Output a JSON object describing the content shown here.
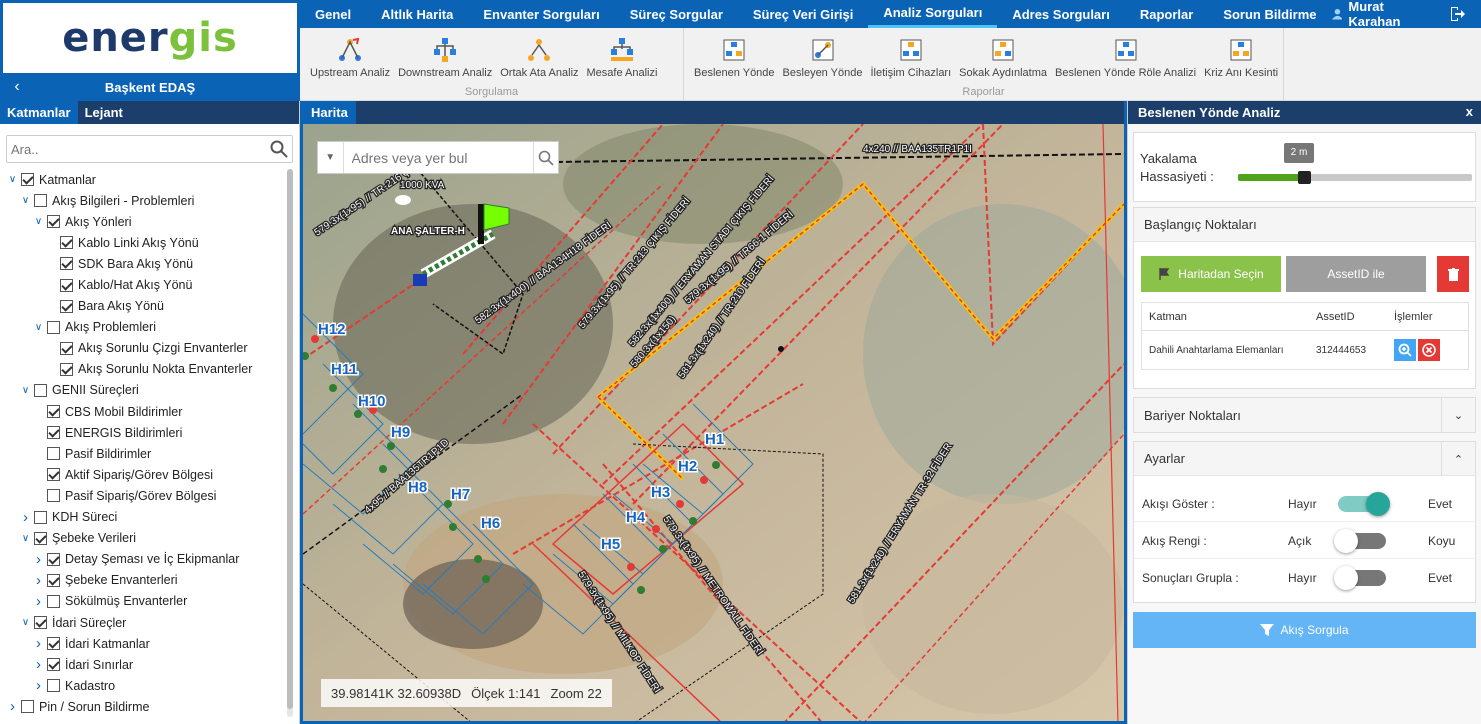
{
  "brand": {
    "logo_part1": "ener",
    "logo_part2": "gis",
    "company": "Başkent EDAŞ"
  },
  "nav": {
    "items": [
      "Genel",
      "Altlık Harita",
      "Envanter Sorguları",
      "Süreç Sorgular",
      "Süreç Veri Girişi",
      "Analiz Sorguları",
      "Adres Sorguları",
      "Raporlar",
      "Sorun Bildirme"
    ],
    "active": "Analiz Sorguları",
    "user": "Murat Karahan"
  },
  "ribbon": {
    "sorgulama": {
      "title": "Sorgulama",
      "buttons": [
        "Upstream Analiz",
        "Downstream Analiz",
        "Ortak Ata Analiz",
        "Mesafe Analizi"
      ]
    },
    "raporlar": {
      "title": "Raporlar",
      "buttons": [
        "Beslenen Yönde",
        "Besleyen Yönde",
        "İletişim Cihazları",
        "Sokak Aydınlatma",
        "Beslenen Yönde Röle Analizi",
        "Kriz Anı Kesinti"
      ]
    }
  },
  "left": {
    "tabs": [
      "Katmanlar",
      "Lejant"
    ],
    "search_placeholder": "Ara..",
    "tree": [
      {
        "label": "Katmanlar",
        "level": 0,
        "caret": "down",
        "checked": true
      },
      {
        "label": "Akış Bilgileri - Problemleri",
        "level": 1,
        "caret": "down",
        "checked": false
      },
      {
        "label": "Akış Yönleri",
        "level": 2,
        "caret": "down",
        "checked": true
      },
      {
        "label": "Kablo Linki Akış Yönü",
        "level": 3,
        "caret": "",
        "checked": true
      },
      {
        "label": "SDK Bara Akış Yönü",
        "level": 3,
        "caret": "",
        "checked": true
      },
      {
        "label": "Kablo/Hat Akış Yönü",
        "level": 3,
        "caret": "",
        "checked": true
      },
      {
        "label": "Bara Akış Yönü",
        "level": 3,
        "caret": "",
        "checked": true
      },
      {
        "label": "Akış Problemleri",
        "level": 2,
        "caret": "down",
        "checked": false
      },
      {
        "label": "Akış Sorunlu Çizgi Envanterler",
        "level": 3,
        "caret": "",
        "checked": true
      },
      {
        "label": "Akış Sorunlu Nokta Envanterler",
        "level": 3,
        "caret": "",
        "checked": true
      },
      {
        "label": "GENII Süreçleri",
        "level": 1,
        "caret": "down",
        "checked": false
      },
      {
        "label": "CBS Mobil Bildirimler",
        "level": 2,
        "caret": "",
        "checked": true
      },
      {
        "label": "ENERGIS Bildirimleri",
        "level": 2,
        "caret": "",
        "checked": true
      },
      {
        "label": "Pasif Bildirimler",
        "level": 2,
        "caret": "",
        "checked": false
      },
      {
        "label": "Aktif Sipariş/Görev Bölgesi",
        "level": 2,
        "caret": "",
        "checked": true
      },
      {
        "label": "Pasif Sipariş/Görev Bölgesi",
        "level": 2,
        "caret": "",
        "checked": false
      },
      {
        "label": "KDH Süreci",
        "level": 1,
        "caret": "right",
        "checked": false
      },
      {
        "label": "Şebeke Verileri",
        "level": 1,
        "caret": "down",
        "checked": true
      },
      {
        "label": "Detay Şeması ve İç Ekipmanlar",
        "level": 2,
        "caret": "right",
        "checked": true
      },
      {
        "label": "Şebeke Envanterleri",
        "level": 2,
        "caret": "right",
        "checked": true
      },
      {
        "label": "Sökülmüş Envanterler",
        "level": 2,
        "caret": "right",
        "checked": false
      },
      {
        "label": "İdari Süreçler",
        "level": 1,
        "caret": "down",
        "checked": true
      },
      {
        "label": "İdari Katmanlar",
        "level": 2,
        "caret": "right",
        "checked": true
      },
      {
        "label": "İdari Sınırlar",
        "level": 2,
        "caret": "right",
        "checked": true
      },
      {
        "label": "Kadastro",
        "level": 2,
        "caret": "right",
        "checked": false
      },
      {
        "label": "Pin / Sorun Bildirme",
        "level": 0,
        "caret": "right",
        "checked": false
      }
    ]
  },
  "map": {
    "tab": "Harita",
    "search_placeholder": "Adres veya yer bul",
    "coords": "39.98141K 32.60938D",
    "scale": "Ölçek 1:141",
    "zoom": "Zoom 22",
    "labels": {
      "line1": "4x240 // BAA135TR1P1I",
      "line2": "579.3x(1x95) // TR-216 ÇIKIŞ",
      "line3": "582.3x(1x400) // BAA134H18 FİDERİ",
      "line4": "579.3x(1x95) // TR-213 ÇIKIŞ FİDERİ",
      "line5": "579.3x(1x95) // TR66-1 FİDERİ",
      "line6": "582.3x(1x400) // ERYAMAN STADI ÇIKIŞ FİDERİ",
      "line7": "580.3x(1x150)",
      "line8": "581.3x(1x240) // TR-210 FİDERİ",
      "line9": "4x95 // BAA135TR1P1D",
      "line10": "579.3x(1x95) // METROMALL FİDERİ",
      "line11": "579.3x(1x95) // MİLKOP FİDERİ",
      "line12": "581.3x(1x240) // ERYAMAN TR-32 FİDER",
      "kva": "1000 KVA",
      "switch": "ANA ŞALTER-H"
    },
    "cells": [
      "H12",
      "H11",
      "H10",
      "H9",
      "H8",
      "H7",
      "H6",
      "H5",
      "H4",
      "H3",
      "H2",
      "H1"
    ]
  },
  "right": {
    "title": "Beslenen Yönde Analiz",
    "close": "x",
    "slider": {
      "label_line1": "Yakalama",
      "label_line2": "Hassasiyeti :",
      "tooltip": "2 m"
    },
    "start_points": {
      "title": "Başlangıç Noktaları",
      "btn_map": "Haritadan Seçin",
      "btn_asset": "AssetID ile",
      "columns": [
        "Katman",
        "AssetID",
        "İşlemler"
      ],
      "rows": [
        {
          "layer": "Dahili Anahtarlama Elemanları",
          "asset": "312444653"
        }
      ]
    },
    "barrier": {
      "title": "Bariyer Noktaları"
    },
    "settings": {
      "title": "Ayarlar",
      "rows": [
        {
          "label": "Akışı Göster :",
          "no": "Hayır",
          "yes": "Evet",
          "on": true
        },
        {
          "label": "Akış Rengi :",
          "no": "Açık",
          "yes": "Koyu",
          "on": false
        },
        {
          "label": "Sonuçları Grupla :",
          "no": "Hayır",
          "yes": "Evet",
          "on": false
        }
      ]
    },
    "run_button": "Akış Sorgula"
  }
}
